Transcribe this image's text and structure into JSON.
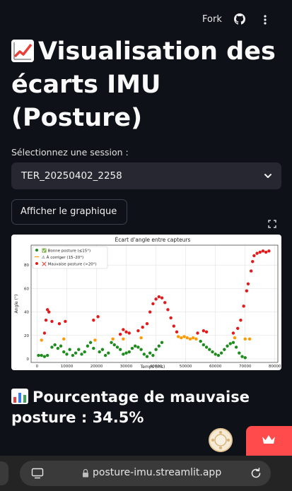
{
  "header": {
    "fork_label": "Fork",
    "github_icon": "github-icon",
    "menu_icon": "vertical-ellipsis-icon"
  },
  "page": {
    "title_emoji": "chart-increasing-emoji",
    "title": "Visualisation des écarts IMU (Posture)"
  },
  "session_select": {
    "label": "Sélectionnez une session :",
    "value": "TER_20250402_2258",
    "chevron_icon": "chevron-down-icon"
  },
  "show_button": {
    "label": "Afficher le graphique"
  },
  "fullscreen_icon": "fullscreen-icon",
  "chart_data": {
    "type": "scatter",
    "title": "Écart d'angle entre capteurs",
    "xlabel": "Temps (ms)",
    "ylabel": "Angle (°)",
    "xlim": [
      -2000,
      81000
    ],
    "ylim": [
      -3,
      97
    ],
    "xticks": [
      "0",
      "10000",
      "20000",
      "30000",
      "40000",
      "50000",
      "60000",
      "70000",
      "80000"
    ],
    "xtick_values": [
      0,
      10000,
      20000,
      30000,
      40000,
      50000,
      60000,
      70000,
      80000
    ],
    "yticks": [
      "0",
      "20",
      "40",
      "60",
      "80"
    ],
    "ytick_values": [
      0,
      20,
      40,
      60,
      80
    ],
    "grid": true,
    "legend_position": "top-left",
    "legend": [
      {
        "marker": "●",
        "label": "✅ Bonne posture (≤15°)",
        "color": "#1e8c1e"
      },
      {
        "marker": "⚠",
        "label": "⚠ À corriger (15–20°)",
        "color": "#ff9900"
      },
      {
        "marker": "●",
        "label": "❌ Mauvaise posture (>20°)",
        "color": "#e31a1c"
      }
    ],
    "series": [
      {
        "name": "✅ Bonne posture (≤15°)",
        "color": "#1e8c1e",
        "points": [
          [
            500,
            3
          ],
          [
            1500,
            3
          ],
          [
            2500,
            2
          ],
          [
            3500,
            3
          ],
          [
            5000,
            10
          ],
          [
            6000,
            12
          ],
          [
            7000,
            9
          ],
          [
            8000,
            11
          ],
          [
            9000,
            6
          ],
          [
            10000,
            4
          ],
          [
            11000,
            8
          ],
          [
            12000,
            3
          ],
          [
            13000,
            5
          ],
          [
            14000,
            8
          ],
          [
            15000,
            4
          ],
          [
            16000,
            6
          ],
          [
            17000,
            11
          ],
          [
            18000,
            14
          ],
          [
            19000,
            9
          ],
          [
            21000,
            6
          ],
          [
            22000,
            8
          ],
          [
            23000,
            3
          ],
          [
            24000,
            5
          ],
          [
            25000,
            14
          ],
          [
            26000,
            12
          ],
          [
            27000,
            10
          ],
          [
            28000,
            8
          ],
          [
            29000,
            4
          ],
          [
            30000,
            5
          ],
          [
            31000,
            6
          ],
          [
            32000,
            9
          ],
          [
            33000,
            11
          ],
          [
            34000,
            10
          ],
          [
            35000,
            8
          ],
          [
            36000,
            4
          ],
          [
            37000,
            2
          ],
          [
            38000,
            5
          ],
          [
            39000,
            3
          ],
          [
            40000,
            8
          ],
          [
            41000,
            11
          ],
          [
            42000,
            14
          ],
          [
            55000,
            15
          ],
          [
            56000,
            12
          ],
          [
            57000,
            10
          ],
          [
            58000,
            8
          ],
          [
            59000,
            6
          ],
          [
            60000,
            4
          ],
          [
            61000,
            3
          ],
          [
            62000,
            5
          ],
          [
            63000,
            8
          ],
          [
            64000,
            11
          ],
          [
            65000,
            13
          ],
          [
            66000,
            14
          ],
          [
            67000,
            10
          ],
          [
            68000,
            5
          ],
          [
            69000,
            2
          ],
          [
            70000,
            1
          ]
        ]
      },
      {
        "name": "⚠ À corriger (15–20°)",
        "color": "#ff9900",
        "points": [
          [
            1500,
            16
          ],
          [
            9000,
            17
          ],
          [
            19500,
            16
          ],
          [
            25500,
            17
          ],
          [
            29000,
            17
          ],
          [
            35000,
            18
          ],
          [
            47500,
            19
          ],
          [
            48500,
            18
          ],
          [
            49500,
            19
          ],
          [
            50500,
            18
          ],
          [
            51500,
            17
          ],
          [
            52500,
            18
          ],
          [
            53500,
            17
          ],
          [
            66500,
            18
          ],
          [
            70000,
            17
          ],
          [
            71500,
            17
          ]
        ]
      },
      {
        "name": "❌ Mauvaise posture (>20°)",
        "color": "#e31a1c",
        "points": [
          [
            2500,
            22
          ],
          [
            3000,
            33
          ],
          [
            3500,
            42
          ],
          [
            4000,
            40
          ],
          [
            5000,
            32
          ],
          [
            7500,
            30
          ],
          [
            9500,
            32
          ],
          [
            19000,
            33
          ],
          [
            20500,
            36
          ],
          [
            28000,
            21
          ],
          [
            29000,
            25
          ],
          [
            30000,
            23
          ],
          [
            31000,
            22
          ],
          [
            34000,
            24
          ],
          [
            35500,
            27
          ],
          [
            37000,
            30
          ],
          [
            38000,
            40
          ],
          [
            39000,
            47
          ],
          [
            40000,
            51
          ],
          [
            41000,
            53
          ],
          [
            42000,
            52
          ],
          [
            43000,
            48
          ],
          [
            44000,
            42
          ],
          [
            45000,
            35
          ],
          [
            46000,
            28
          ],
          [
            47000,
            23
          ],
          [
            54000,
            22
          ],
          [
            56000,
            24
          ],
          [
            57000,
            23
          ],
          [
            66000,
            22
          ],
          [
            67500,
            26
          ],
          [
            68500,
            33
          ],
          [
            69500,
            45
          ],
          [
            70500,
            58
          ],
          [
            71000,
            64
          ],
          [
            72000,
            75
          ],
          [
            72500,
            83
          ],
          [
            73000,
            88
          ],
          [
            74000,
            90
          ],
          [
            75000,
            91
          ],
          [
            76000,
            92
          ],
          [
            77000,
            91
          ],
          [
            78000,
            92
          ]
        ]
      }
    ]
  },
  "summary": {
    "emoji": "bar-chart-emoji",
    "text": "Pourcentage de mauvaise posture : 34.5%"
  },
  "browser": {
    "url": "posture-imu.streamlit.app",
    "tabs_icon": "tabs-icon",
    "lock_icon": "lock-icon",
    "reload_icon": "reload-icon"
  },
  "colors": {
    "background": "#0e1117",
    "select_bg": "#262730",
    "streamlit_badge": "#ff4b4b"
  }
}
